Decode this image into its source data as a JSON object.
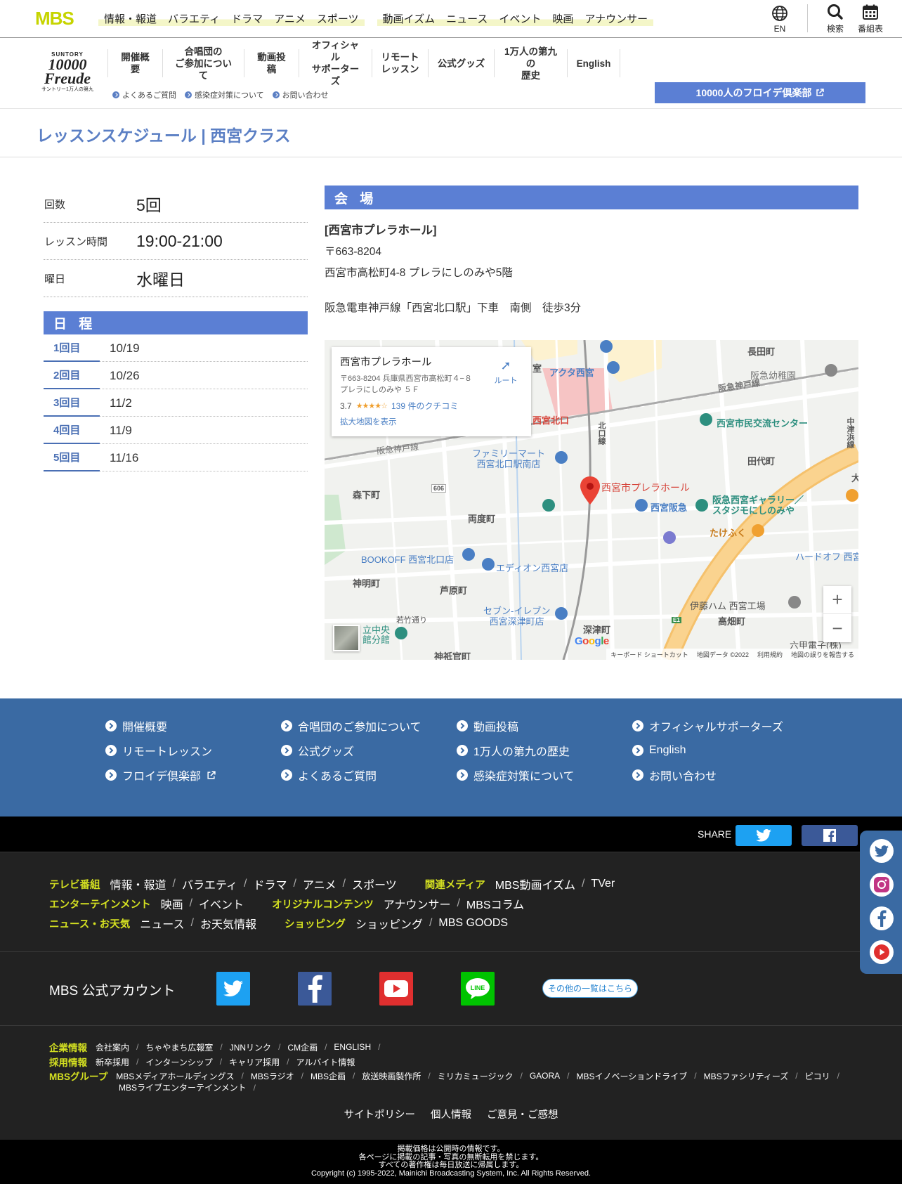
{
  "mbs": {
    "logo": "MBS",
    "nav": [
      "情報・報道",
      "バラエティ",
      "ドラマ",
      "アニメ",
      "スポーツ"
    ],
    "nav2": [
      "動画イズム",
      "ニュース",
      "イベント",
      "映画",
      "アナウンサー"
    ],
    "tools": {
      "en": "EN",
      "search": "検索",
      "schedule": "番組表"
    }
  },
  "freude": {
    "logo_top": "SUNTORY",
    "logo_mid": "10000 Freude",
    "logo_bottom": "サントリー1万人の第九",
    "nav": [
      "開催概要",
      "合唱団の\nご参加について",
      "動画投稿",
      "オフィシャル\nサポーターズ",
      "リモート\nレッスン",
      "公式グッズ",
      "1万人の第九の\n歴史",
      "English"
    ],
    "sublinks": [
      "よくあるご質問",
      "感染症対策について",
      "お問い合わせ"
    ],
    "club_button": "10000人のフロイデ倶楽部"
  },
  "page_title": "レッスンスケジュール | 西宮クラス",
  "info": [
    {
      "key": "回数",
      "value": "5回"
    },
    {
      "key": "レッスン時間",
      "value": "19:00-21:00"
    },
    {
      "key": "曜日",
      "value": "水曜日"
    }
  ],
  "schedule_title": "日 程",
  "schedule": [
    {
      "n": "1回目",
      "date": "10/19"
    },
    {
      "n": "2回目",
      "date": "10/26"
    },
    {
      "n": "3回目",
      "date": "11/2"
    },
    {
      "n": "4回目",
      "date": "11/9"
    },
    {
      "n": "5回目",
      "date": "11/16"
    }
  ],
  "venue": {
    "title": "会 場",
    "name": "[西宮市プレラホール]",
    "zip": "〒663-8204",
    "address": "西宮市高松町4-8 プレラにしのみや5階",
    "access": "阪急電車神戸線「西宮北口駅」下車　南側　徒歩3分"
  },
  "map": {
    "card_title": "西宮市プレラホール",
    "card_address": "〒663-8204 兵庫県西宮市高松町４−８ プレラにしのみや ５Ｆ",
    "rating": "3.7",
    "stars": "★★★★☆",
    "reviews": "139 件のクチコミ",
    "enlarge": "拡大地図を表示",
    "route": "ルート",
    "pin_label": "西宮市プレラホール",
    "labels": {
      "nagataicho": "長田町",
      "hankyu_kindergarten": "阪急幼稚園",
      "kobe_line1": "阪急神戸線",
      "akuta": "アクタ西宮",
      "station": "西宮北口",
      "kitaguchi_line": "北口線",
      "civic_center": "西宮市民交流センター",
      "nakatsu": "中津浜線",
      "kobe_line2": "阪急神戸線",
      "familymart": "ファミリーマート\n西宮北口駅南店",
      "tashiro": "田代町",
      "morishita": "森下町",
      "route606": "606",
      "ryodo": "両度町",
      "hankyu_nishinomiya": "西宮阪急",
      "gallery": "阪急西宮ギャラリー／\nスタジモにしのみや",
      "takefuku": "たけふく",
      "bookoff": "BOOKOFF 西宮北口店",
      "aeon": "エディオン西宮店",
      "hardoff": "ハードオフ 西宮",
      "jinmei": "神明町",
      "ashihara": "芦原町",
      "seven": "セブン-イレブン\n西宮深津町店",
      "wakatake": "若竹通り",
      "itoham": "伊藤ハム 西宮工場",
      "takabata": "高畑町",
      "tachinaka": "立中央\n館分館",
      "fukatsu": "深津町",
      "rokko": "六甲電子(株)",
      "jingikan": "神祇官町",
      "e1": "E1",
      "ta": "大",
      "shitsu": "室"
    },
    "zoom_in": "+",
    "zoom_out": "−",
    "footer": [
      "キーボード ショートカット",
      "地図データ ©2022",
      "利用規約",
      "地図の誤りを報告する"
    ]
  },
  "blue_footer": [
    "開催概要",
    "合唱団のご参加について",
    "動画投稿",
    "オフィシャルサポーターズ",
    "リモートレッスン",
    "公式グッズ",
    "1万人の第九の歴史",
    "English",
    "フロイデ倶楽部",
    "よくあるご質問",
    "感染症対策について",
    "お問い合わせ"
  ],
  "share": {
    "label": "SHARE"
  },
  "dark_footer": {
    "rows": [
      {
        "groups": [
          {
            "cat": "テレビ番組",
            "links": [
              "情報・報道",
              "バラエティ",
              "ドラマ",
              "アニメ",
              "スポーツ"
            ]
          },
          {
            "cat": "関連メディア",
            "links": [
              "MBS動画イズム",
              "TVer"
            ]
          }
        ]
      },
      {
        "groups": [
          {
            "cat": "エンターテインメント",
            "links": [
              "映画",
              "イベント"
            ]
          },
          {
            "cat": "オリジナルコンテンツ",
            "links": [
              "アナウンサー",
              "MBSコラム"
            ]
          }
        ]
      },
      {
        "groups": [
          {
            "cat": "ニュース・お天気",
            "links": [
              "ニュース",
              "お天気情報"
            ]
          },
          {
            "cat": "ショッピング",
            "links": [
              "ショッピング",
              "MBS GOODS"
            ]
          }
        ]
      }
    ],
    "accounts_label": "MBS 公式アカウント",
    "accounts_more": "その他の一覧はこちら",
    "corp": [
      {
        "cat": "企業情報",
        "links": [
          "会社案内",
          "ちゃやまち広報室",
          "JNNリンク",
          "CM企画",
          "ENGLISH"
        ]
      },
      {
        "cat": "採用情報",
        "links": [
          "新卒採用",
          "インターンシップ",
          "キャリア採用",
          "アルバイト情報"
        ]
      },
      {
        "cat": "MBSグループ",
        "links": [
          "MBSメディアホールディングス",
          "MBSラジオ",
          "MBS企画",
          "放送映画製作所",
          "ミリカミュージック",
          "GAORA",
          "MBSイノベーションドライブ",
          "MBSファシリティーズ",
          "ピコリ"
        ]
      }
    ],
    "corp_extra": "MBSライブエンターテインメント",
    "policy": [
      "サイトポリシー",
      "個人情報",
      "ご意見・ご感想"
    ]
  },
  "copyright": [
    "掲載価格は公開時の情報です。",
    "各ページに掲載の記事・写真の無断転用を禁じます。",
    "すべての著作権は毎日放送に帰属します。",
    "Copyright (c) 1995-2022, Mainichi Broadcasting System, Inc. All Rights Reserved."
  ],
  "colors": {
    "accent": "#5b7fd4",
    "mbs_green": "#c6d400",
    "footer_blue": "#3a6aa3",
    "category_yellow": "#d4e021"
  }
}
